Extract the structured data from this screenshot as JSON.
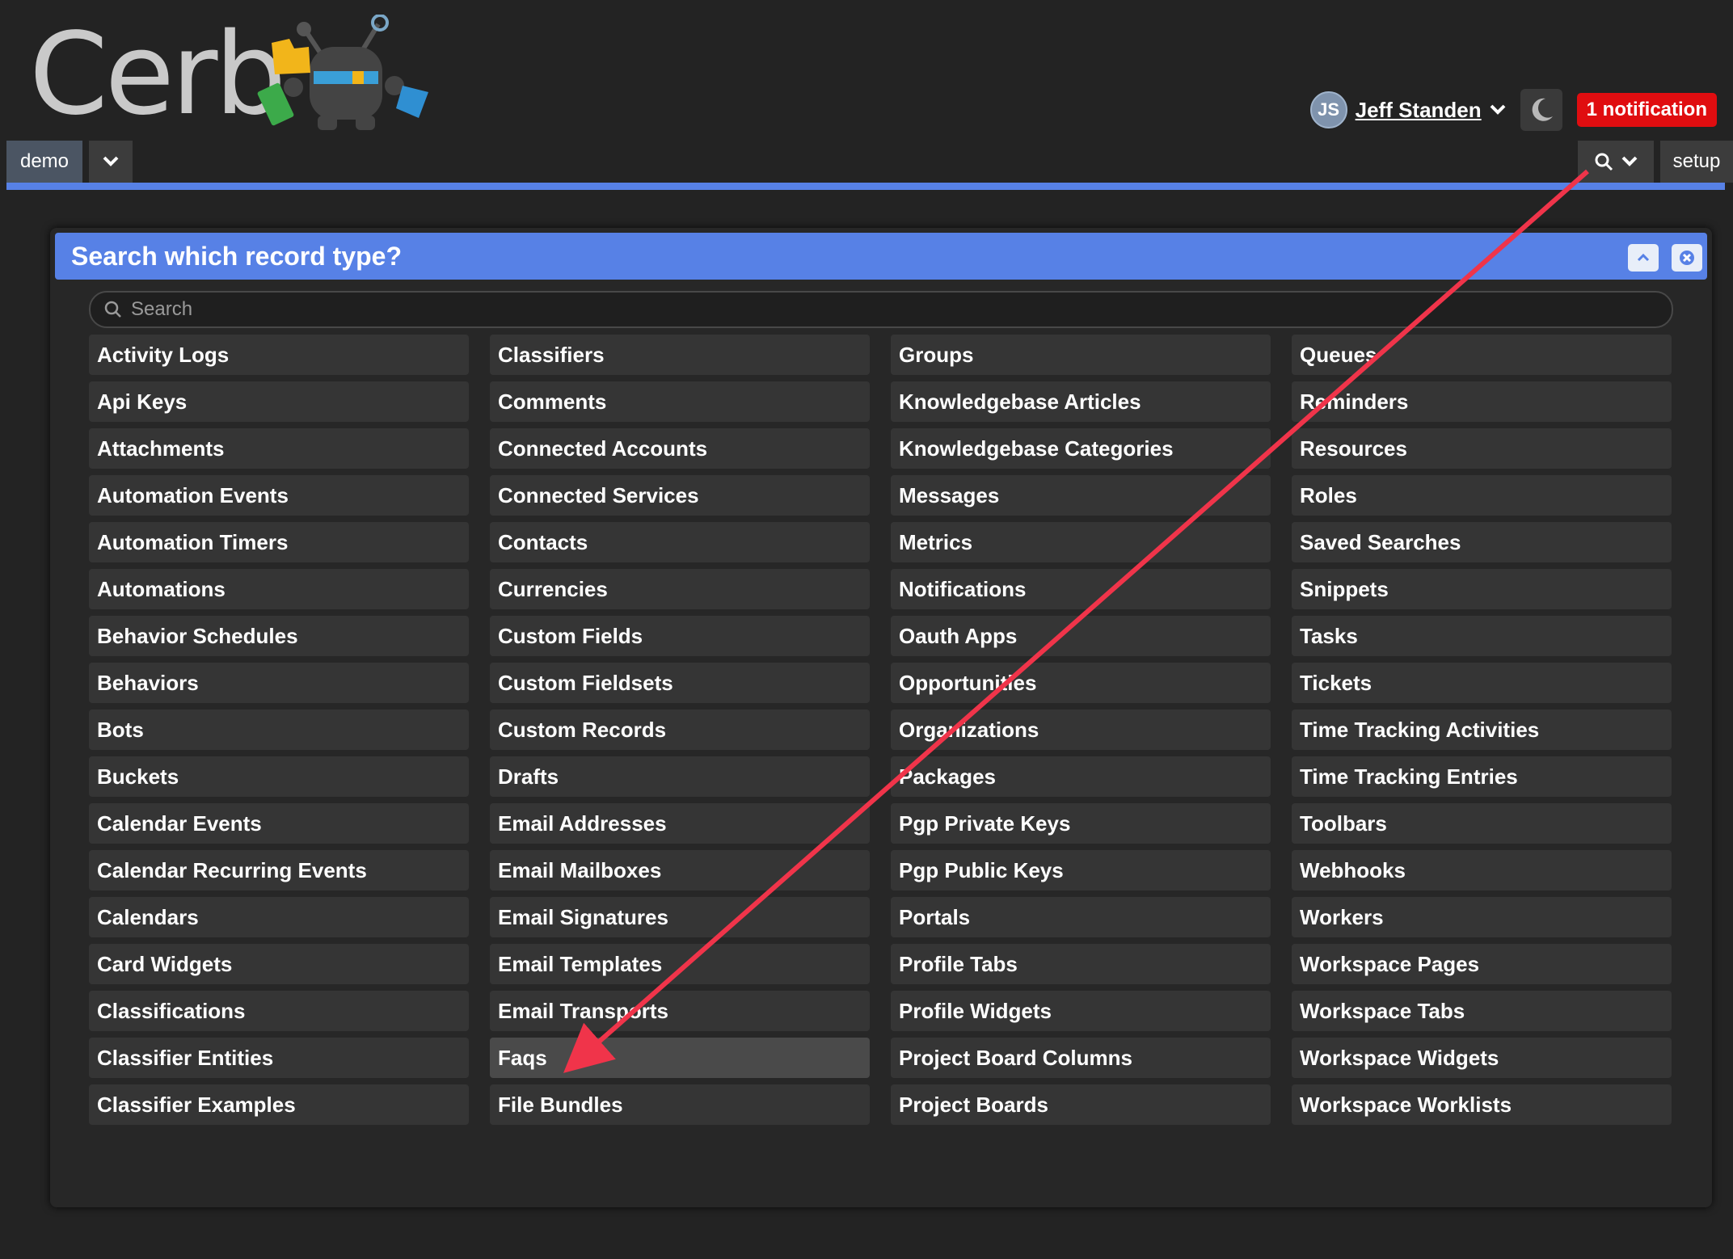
{
  "logo": {
    "text": "Cerb"
  },
  "user": {
    "initials": "JS",
    "name": "Jeff Standen"
  },
  "notifications": {
    "label": "1 notification"
  },
  "nav": {
    "workspace": "demo",
    "setup": "setup"
  },
  "dialog": {
    "title": "Search which record type?",
    "search_placeholder": "Search",
    "hovered_item": "Faqs",
    "record_types": [
      "Activity Logs",
      "Api Keys",
      "Attachments",
      "Automation Events",
      "Automation Timers",
      "Automations",
      "Behavior Schedules",
      "Behaviors",
      "Bots",
      "Buckets",
      "Calendar Events",
      "Calendar Recurring Events",
      "Calendars",
      "Card Widgets",
      "Classifications",
      "Classifier Entities",
      "Classifier Examples",
      "Classifiers",
      "Comments",
      "Connected Accounts",
      "Connected Services",
      "Contacts",
      "Currencies",
      "Custom Fields",
      "Custom Fieldsets",
      "Custom Records",
      "Drafts",
      "Email Addresses",
      "Email Mailboxes",
      "Email Signatures",
      "Email Templates",
      "Email Transports",
      "Faqs",
      "File Bundles",
      "Groups",
      "Knowledgebase Articles",
      "Knowledgebase Categories",
      "Messages",
      "Metrics",
      "Notifications",
      "Oauth Apps",
      "Opportunities",
      "Organizations",
      "Packages",
      "Pgp Private Keys",
      "Pgp Public Keys",
      "Portals",
      "Profile Tabs",
      "Profile Widgets",
      "Project Board Columns",
      "Project Boards",
      "Queues",
      "Reminders",
      "Resources",
      "Roles",
      "Saved Searches",
      "Snippets",
      "Tasks",
      "Tickets",
      "Time Tracking Activities",
      "Time Tracking Entries",
      "Toolbars",
      "Webhooks",
      "Workers",
      "Workspace Pages",
      "Workspace Tabs",
      "Workspace Widgets",
      "Workspace Worklists"
    ]
  },
  "colors": {
    "accent": "#5781e6",
    "notification": "#e00d10",
    "annotation_arrow": "#f0344a"
  }
}
